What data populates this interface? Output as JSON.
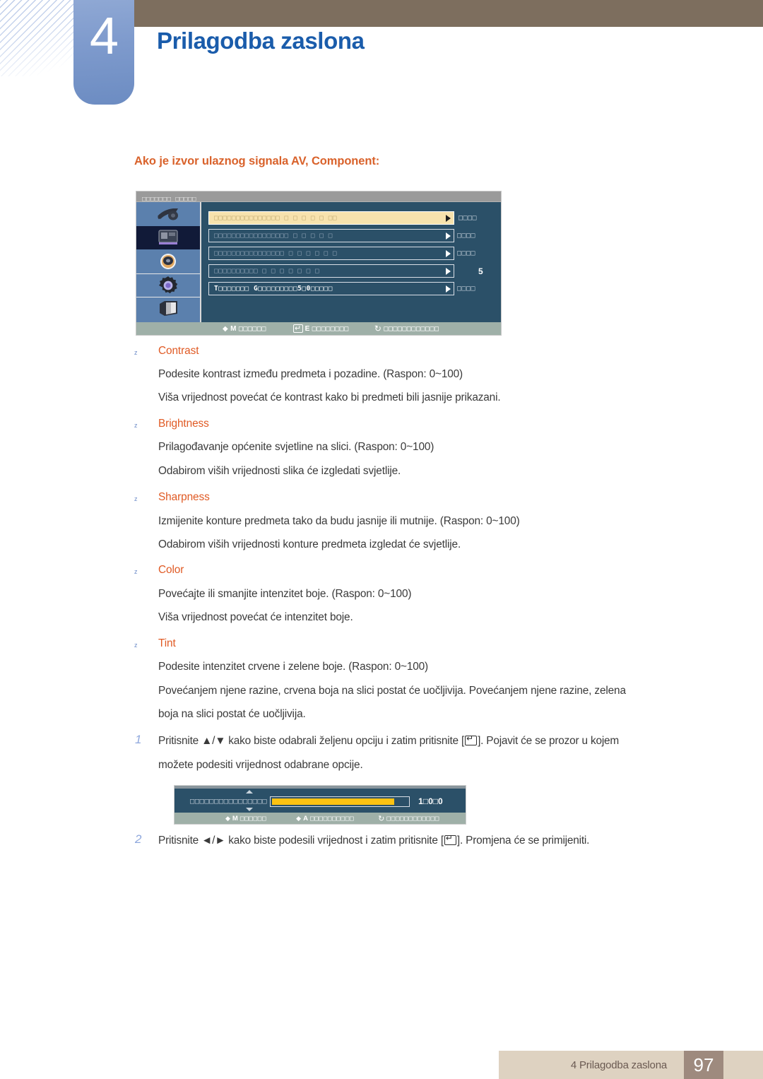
{
  "chapter": {
    "number": "4",
    "title": "Prilagodba zaslona"
  },
  "section": {
    "heading": "Ako je izvor ulaznog signala AV, Component:"
  },
  "osd_menu": {
    "titlebar_text": "□□□□□□□ □□□□□",
    "sidebar_icons": [
      "input-source-icon",
      "picture-icon",
      "sound-icon",
      "system-gear-icon",
      "display-monitor-icon"
    ],
    "selected_icon_index": 1,
    "rows": [
      {
        "label": "□□□□□□□□□□□□□□□   □    □    □    □    □   □□",
        "value": "□□□□",
        "active": true
      },
      {
        "label": "□□□□□□□□□□□□□□□□□   □    □   □   □   □",
        "value": "□□□□",
        "active": false
      },
      {
        "label": "□□□□□□□□□□□□□□□□ □   □   □   □   □   □",
        "value": "□□□□",
        "active": false
      },
      {
        "label": "□□□□□□□□□□  □   □   □   □   □   □   □",
        "value": "5",
        "active": false
      },
      {
        "label": "T□□□□□□□                      G□□□□□□□□□5□0□□□□□",
        "value": "□□□□",
        "active": false
      }
    ],
    "footer_hints": [
      {
        "key": "M",
        "text": "□□□□□□"
      },
      {
        "key": "E",
        "text": "□□□□□□□□"
      },
      {
        "key": "",
        "text": "□□□□□□□□□□□□"
      }
    ]
  },
  "options": [
    {
      "name": "Contrast",
      "lines": [
        "Podesite kontrast između predmeta i pozadine. (Raspon: 0~100)",
        "Viša vrijednost povećat će kontrast kako bi predmeti bili jasnije prikazani."
      ]
    },
    {
      "name": "Brightness",
      "lines": [
        "Prilagođavanje općenite svjetline na slici. (Raspon: 0~100)",
        "Odabirom viših vrijednosti slika će izgledati svjetlije."
      ]
    },
    {
      "name": "Sharpness",
      "lines": [
        "Izmijenite konture predmeta tako da budu jasnije ili mutnije. (Raspon: 0~100)",
        "Odabirom viših vrijednosti konture predmeta izgledat će svjetlije."
      ]
    },
    {
      "name": "Color",
      "lines": [
        "Povećajte ili smanjite intenzitet boje. (Raspon: 0~100)",
        "Viša vrijednost povećat će intenzitet boje."
      ]
    },
    {
      "name": "Tint",
      "lines": [
        "Podesite intenzitet crvene i zelene boje. (Raspon: 0~100)",
        "Povećanjem njene razine, crvena boja na slici postat će uočljivija. Povećanjem njene razine, zelena",
        "boja na slici postat će uočljivija."
      ]
    }
  ],
  "steps": [
    {
      "number": "1",
      "part1": "Pritisnite ▲/▼ kako biste odabrali željenu opciju i zatim pritisnite [",
      "part2": "]. Pojavit će se prozor u kojem",
      "line2": "možete podesiti vrijednost odabrane opcije."
    },
    {
      "number": "2",
      "part1": "Pritisnite ◄/► kako biste podesili vrijednost i zatim pritisnite [",
      "part2": "]. Promjena će se primijeniti.",
      "line2": ""
    }
  ],
  "slider_osd": {
    "label": "□□□□□□□□□□□□□□□□",
    "value": "1□0□0",
    "fill_percent": "88",
    "footer_hints": [
      {
        "key": "M",
        "text": "□□□□□□"
      },
      {
        "key": "A",
        "text": "□□□□□□□□□□"
      },
      {
        "key": "",
        "text": "□□□□□□□□□□□□"
      }
    ]
  },
  "footer": {
    "text": "4 Prilagodba zaslona",
    "page": "97"
  },
  "colors": {
    "accent_orange": "#e05a24",
    "heading_orange": "#d9622b",
    "title_blue": "#1a5cab",
    "tab_blue": "#7f9bcd",
    "header_brown": "#7d6e5e",
    "footer_band": "#ded2c1",
    "footer_page": "#9e8a7e",
    "osd_bg": "#2b5068",
    "osd_highlight": "#f7e2ad",
    "slider_fill": "#fcc212"
  }
}
